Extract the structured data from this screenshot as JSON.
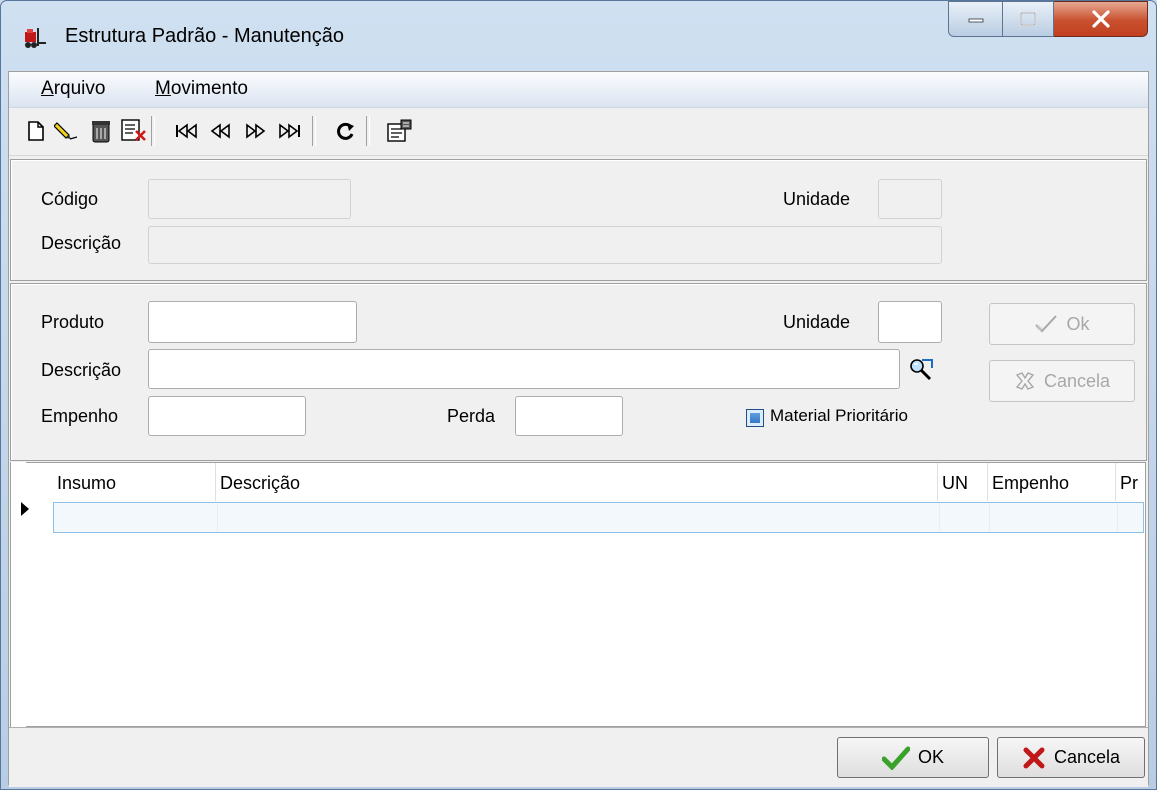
{
  "window": {
    "title": "Estrutura Padrão - Manutenção"
  },
  "menu": [
    {
      "prefix": "A",
      "rest": "rquivo"
    },
    {
      "prefix": "M",
      "rest": "ovimento"
    }
  ],
  "toolbar": {
    "icons": [
      "new-document-icon",
      "edit-pencil-icon",
      "delete-trash-icon",
      "print-preview-icon",
      "first-record-icon",
      "previous-record-icon",
      "next-record-icon",
      "last-record-icon",
      "refresh-icon",
      "properties-icon"
    ]
  },
  "header": {
    "codigo_label": "Código",
    "codigo_value": "",
    "unidade_label": "Unidade",
    "unidade_value": "",
    "descricao_label": "Descrição",
    "descricao_value": ""
  },
  "item": {
    "produto_label": "Produto",
    "produto_value": "",
    "unidade_label": "Unidade",
    "unidade_value": "",
    "descricao_label": "Descrição",
    "descricao_value": "",
    "empenho_label": "Empenho",
    "empenho_value": "",
    "perda_label": "Perda",
    "perda_value": "",
    "material_label": "Material Prioritário",
    "ok_label": "Ok",
    "cancela_label": "Cancela"
  },
  "grid": {
    "columns": [
      "Insumo",
      "Descrição",
      "UN",
      "Empenho",
      "Pr"
    ],
    "rows": []
  },
  "footer": {
    "ok_label": "OK",
    "cancela_label": "Cancela"
  },
  "colors": {
    "ok_check": "#3aa12a",
    "cancel_x": "#c01818",
    "close_button": "#c9502f",
    "checkbox": "#2a6dc0"
  }
}
